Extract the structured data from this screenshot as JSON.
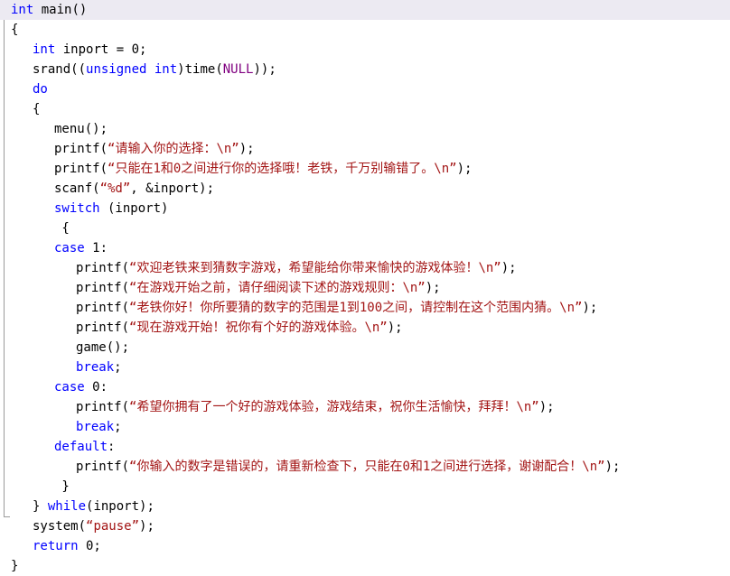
{
  "editor": {
    "language": "c",
    "colors": {
      "background": "#ffffff",
      "plain_text": "#000000",
      "keyword": "#0000ff",
      "string": "#a31515",
      "macro": "#800080",
      "current_line_highlight": "#eceaf2",
      "fold_guide": "#9a9a9a"
    },
    "fold_marker": {
      "name": "collapse-region-minus",
      "state": "expanded",
      "glyph": "-"
    }
  },
  "lines": [
    {
      "n": 1,
      "indent": 0,
      "highlight": true,
      "tokens": [
        {
          "t": "kw",
          "v": "int"
        },
        {
          "t": "pln",
          "v": " main()"
        }
      ]
    },
    {
      "n": 2,
      "indent": 0,
      "highlight": false,
      "tokens": [
        {
          "t": "pln",
          "v": "{"
        }
      ]
    },
    {
      "n": 3,
      "indent": 1,
      "highlight": false,
      "tokens": [
        {
          "t": "kw",
          "v": "int"
        },
        {
          "t": "pln",
          "v": " inport = 0;"
        }
      ]
    },
    {
      "n": 4,
      "indent": 1,
      "highlight": false,
      "tokens": [
        {
          "t": "pln",
          "v": "srand(("
        },
        {
          "t": "kw",
          "v": "unsigned int"
        },
        {
          "t": "pln",
          "v": ")time("
        },
        {
          "t": "mac",
          "v": "NULL"
        },
        {
          "t": "pln",
          "v": "));"
        }
      ]
    },
    {
      "n": 5,
      "indent": 1,
      "highlight": false,
      "tokens": [
        {
          "t": "kw",
          "v": "do"
        }
      ]
    },
    {
      "n": 6,
      "indent": 1,
      "highlight": false,
      "tokens": [
        {
          "t": "pln",
          "v": "{"
        }
      ]
    },
    {
      "n": 7,
      "indent": 2,
      "highlight": false,
      "tokens": [
        {
          "t": "pln",
          "v": "menu();"
        }
      ]
    },
    {
      "n": 8,
      "indent": 2,
      "highlight": false,
      "tokens": [
        {
          "t": "pln",
          "v": "printf("
        },
        {
          "t": "str",
          "v": "“请输入你的选择：\\n”"
        },
        {
          "t": "pln",
          "v": ");"
        }
      ]
    },
    {
      "n": 9,
      "indent": 2,
      "highlight": false,
      "tokens": [
        {
          "t": "pln",
          "v": "printf("
        },
        {
          "t": "str",
          "v": "“只能在1和0之间进行你的选择哦！老铁，千万别输错了。\\n”"
        },
        {
          "t": "pln",
          "v": ");"
        }
      ]
    },
    {
      "n": 10,
      "indent": 2,
      "highlight": false,
      "tokens": [
        {
          "t": "pln",
          "v": "scanf("
        },
        {
          "t": "str",
          "v": "“%d”"
        },
        {
          "t": "pln",
          "v": ", &inport);"
        }
      ]
    },
    {
      "n": 11,
      "indent": 2,
      "highlight": false,
      "tokens": [
        {
          "t": "kw",
          "v": "switch"
        },
        {
          "t": "pln",
          "v": " (inport)"
        }
      ]
    },
    {
      "n": 12,
      "indent": 2,
      "highlight": false,
      "tokens": [
        {
          "t": "pln",
          "v": " {"
        }
      ]
    },
    {
      "n": 13,
      "indent": 2,
      "highlight": false,
      "tokens": [
        {
          "t": "kw",
          "v": "case"
        },
        {
          "t": "pln",
          "v": " 1:"
        }
      ]
    },
    {
      "n": 14,
      "indent": 3,
      "highlight": false,
      "tokens": [
        {
          "t": "pln",
          "v": "printf("
        },
        {
          "t": "str",
          "v": "“欢迎老铁来到猜数字游戏，希望能给你带来愉快的游戏体验！\\n”"
        },
        {
          "t": "pln",
          "v": ");"
        }
      ]
    },
    {
      "n": 15,
      "indent": 3,
      "highlight": false,
      "tokens": [
        {
          "t": "pln",
          "v": "printf("
        },
        {
          "t": "str",
          "v": "“在游戏开始之前，请仔细阅读下述的游戏规则：\\n”"
        },
        {
          "t": "pln",
          "v": ");"
        }
      ]
    },
    {
      "n": 16,
      "indent": 3,
      "highlight": false,
      "tokens": [
        {
          "t": "pln",
          "v": "printf("
        },
        {
          "t": "str",
          "v": "“老铁你好！你所要猜的数字的范围是1到100之间，请控制在这个范围内猜。\\n”"
        },
        {
          "t": "pln",
          "v": ");"
        }
      ]
    },
    {
      "n": 17,
      "indent": 3,
      "highlight": false,
      "tokens": [
        {
          "t": "pln",
          "v": "printf("
        },
        {
          "t": "str",
          "v": "“现在游戏开始！祝你有个好的游戏体验。\\n”"
        },
        {
          "t": "pln",
          "v": ");"
        }
      ]
    },
    {
      "n": 18,
      "indent": 3,
      "highlight": false,
      "tokens": [
        {
          "t": "pln",
          "v": "game();"
        }
      ]
    },
    {
      "n": 19,
      "indent": 3,
      "highlight": false,
      "tokens": [
        {
          "t": "kw",
          "v": "break"
        },
        {
          "t": "pln",
          "v": ";"
        }
      ]
    },
    {
      "n": 20,
      "indent": 2,
      "highlight": false,
      "tokens": [
        {
          "t": "kw",
          "v": "case"
        },
        {
          "t": "pln",
          "v": " 0:"
        }
      ]
    },
    {
      "n": 21,
      "indent": 3,
      "highlight": false,
      "tokens": [
        {
          "t": "pln",
          "v": "printf("
        },
        {
          "t": "str",
          "v": "“希望你拥有了一个好的游戏体验，游戏结束，祝你生活愉快，拜拜！\\n”"
        },
        {
          "t": "pln",
          "v": ");"
        }
      ]
    },
    {
      "n": 22,
      "indent": 3,
      "highlight": false,
      "tokens": [
        {
          "t": "kw",
          "v": "break"
        },
        {
          "t": "pln",
          "v": ";"
        }
      ]
    },
    {
      "n": 23,
      "indent": 2,
      "highlight": false,
      "tokens": [
        {
          "t": "kw",
          "v": "default"
        },
        {
          "t": "pln",
          "v": ":"
        }
      ]
    },
    {
      "n": 24,
      "indent": 3,
      "highlight": false,
      "tokens": [
        {
          "t": "pln",
          "v": "printf("
        },
        {
          "t": "str",
          "v": "“你输入的数字是错误的，请重新检查下，只能在0和1之间进行选择，谢谢配合！\\n”"
        },
        {
          "t": "pln",
          "v": ");"
        }
      ]
    },
    {
      "n": 25,
      "indent": 2,
      "highlight": false,
      "tokens": [
        {
          "t": "pln",
          "v": " }"
        }
      ]
    },
    {
      "n": 26,
      "indent": 1,
      "highlight": false,
      "tokens": [
        {
          "t": "pln",
          "v": "} "
        },
        {
          "t": "kw",
          "v": "while"
        },
        {
          "t": "pln",
          "v": "(inport);"
        }
      ]
    },
    {
      "n": 27,
      "indent": 1,
      "highlight": false,
      "tokens": [
        {
          "t": "pln",
          "v": "system("
        },
        {
          "t": "str",
          "v": "“pause”"
        },
        {
          "t": "pln",
          "v": ");"
        }
      ]
    },
    {
      "n": 28,
      "indent": 1,
      "highlight": false,
      "tokens": [
        {
          "t": "kw",
          "v": "return"
        },
        {
          "t": "pln",
          "v": " 0;"
        }
      ]
    },
    {
      "n": 29,
      "indent": 0,
      "highlight": false,
      "tokens": [
        {
          "t": "pln",
          "v": "}"
        }
      ]
    }
  ]
}
